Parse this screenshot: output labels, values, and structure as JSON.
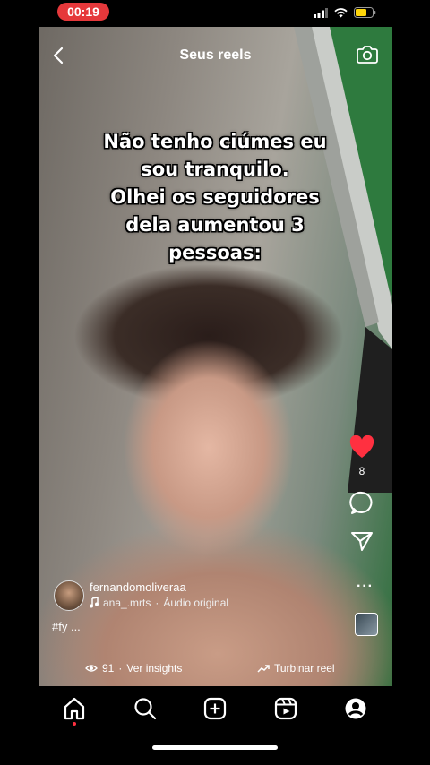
{
  "status_bar": {
    "time": "00:19"
  },
  "header": {
    "title": "Seus reels"
  },
  "reel": {
    "overlay_text": "Não tenho ciúmes eu\nsou tranquilo.\nOlhei os seguidores\ndela aumentou 3\npessoas:",
    "like_count": "8",
    "author": "fernandomoliveraa",
    "audio_author": "ana_.mrts",
    "audio_separator": "·",
    "audio_title": "Áudio original",
    "caption": "#fy ...",
    "views": "91",
    "views_separator": "·",
    "insights_label": "Ver insights",
    "boost_label": "Turbinar reel"
  },
  "colors": {
    "time_pill": "#e5383b",
    "like_heart": "#ff3040",
    "battery": "#ffd60a"
  },
  "icons": [
    "back-icon",
    "camera-icon",
    "heart-icon",
    "comment-icon",
    "share-icon",
    "more-icon",
    "music-note-icon",
    "eye-icon",
    "boost-icon",
    "home-icon",
    "search-icon",
    "create-icon",
    "reels-icon",
    "profile-icon"
  ]
}
